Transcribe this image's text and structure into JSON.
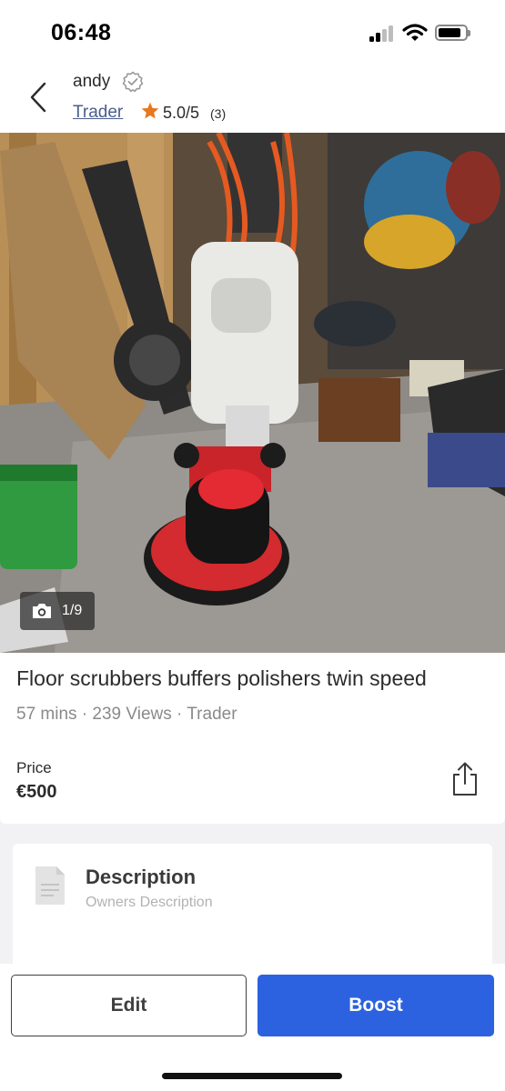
{
  "status_bar": {
    "time": "06:48"
  },
  "seller": {
    "name": "andy",
    "badge": "Trader",
    "rating": "5.0/5",
    "rating_count": "(3)"
  },
  "photo": {
    "counter": "1/9"
  },
  "listing": {
    "title": "Floor scrubbers buffers polishers twin speed",
    "meta": "57 mins · 239 Views · Trader",
    "price_label": "Price",
    "price": "€500"
  },
  "description": {
    "title": "Description",
    "subtitle": "Owners Description"
  },
  "actions": {
    "edit_label": "Edit",
    "boost_label": "Boost"
  },
  "icons": {
    "back": "chevron-left-icon",
    "verified": "verified-badge-icon",
    "star": "star-icon",
    "camera": "camera-icon",
    "share": "share-icon",
    "document": "document-icon"
  },
  "colors": {
    "accent_blue": "#2c62e0",
    "star_orange": "#e8781e",
    "link": "#4a5d8c",
    "muted_text": "#8a8a8a",
    "background": "#f2f2f4"
  }
}
